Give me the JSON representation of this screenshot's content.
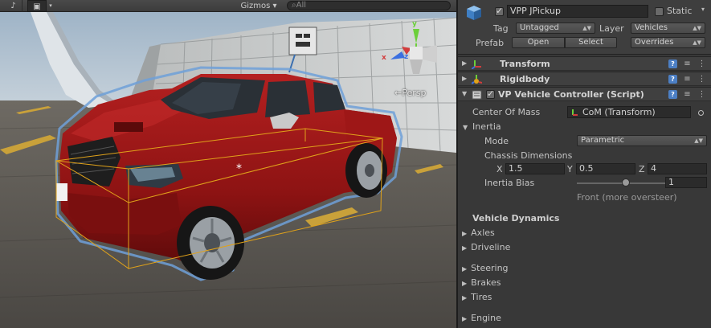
{
  "scene": {
    "toolbar": {
      "audio_glyph": "♪",
      "effects_glyph": "▣",
      "dropdown_glyph": "▾",
      "gizmos_label": "Gizmos ▾",
      "search_placeholder": "⌕All"
    },
    "persp_label": "←Persp",
    "gizmo_axes": {
      "x": "x",
      "y": "y",
      "z": "z"
    },
    "colors": {
      "selection_outline": "#6fa0d8",
      "collider_box": "#e0a21a",
      "car_body": "#8d1313"
    }
  },
  "inspector": {
    "gameobject": {
      "active": true,
      "name": "VPP JPickup",
      "static_label": "Static",
      "static_checked": false,
      "tag_label": "Tag",
      "tag_value": "Untagged",
      "layer_label": "Layer",
      "layer_value": "Vehicles",
      "prefab_label": "Prefab",
      "open_label": "Open",
      "select_label": "Select",
      "overrides_label": "Overrides"
    },
    "components": [
      {
        "title": "Transform",
        "fold": "▶"
      },
      {
        "title": "Rigidbody",
        "fold": "▶"
      },
      {
        "title": "VP Vehicle Controller (Script)",
        "fold": "▼",
        "enabled": true
      }
    ],
    "vehicle_controller": {
      "center_of_mass_label": "Center Of Mass",
      "center_of_mass_value": "CoM (Transform)",
      "inertia_label": "Inertia",
      "mode_label": "Mode",
      "mode_value": "Parametric",
      "chassis_dimensions_label": "Chassis Dimensions",
      "chassis": {
        "x_label": "X",
        "x": "1.5",
        "y_label": "Y",
        "y": "0.5",
        "z_label": "Z",
        "z": "4"
      },
      "inertia_bias_label": "Inertia Bias",
      "inertia_bias_value": "1",
      "inertia_bias_help": "Front (more oversteer)",
      "vehicle_dynamics_title": "Vehicle Dynamics",
      "sections": [
        "Axles",
        "Driveline",
        "Steering",
        "Brakes",
        "Tires",
        "Engine"
      ]
    },
    "fold_glyphs": {
      "collapsed": "▶",
      "expanded": "▼"
    },
    "header_buttons": {
      "help": "?",
      "preset": "≡",
      "gear": "⋮"
    }
  }
}
